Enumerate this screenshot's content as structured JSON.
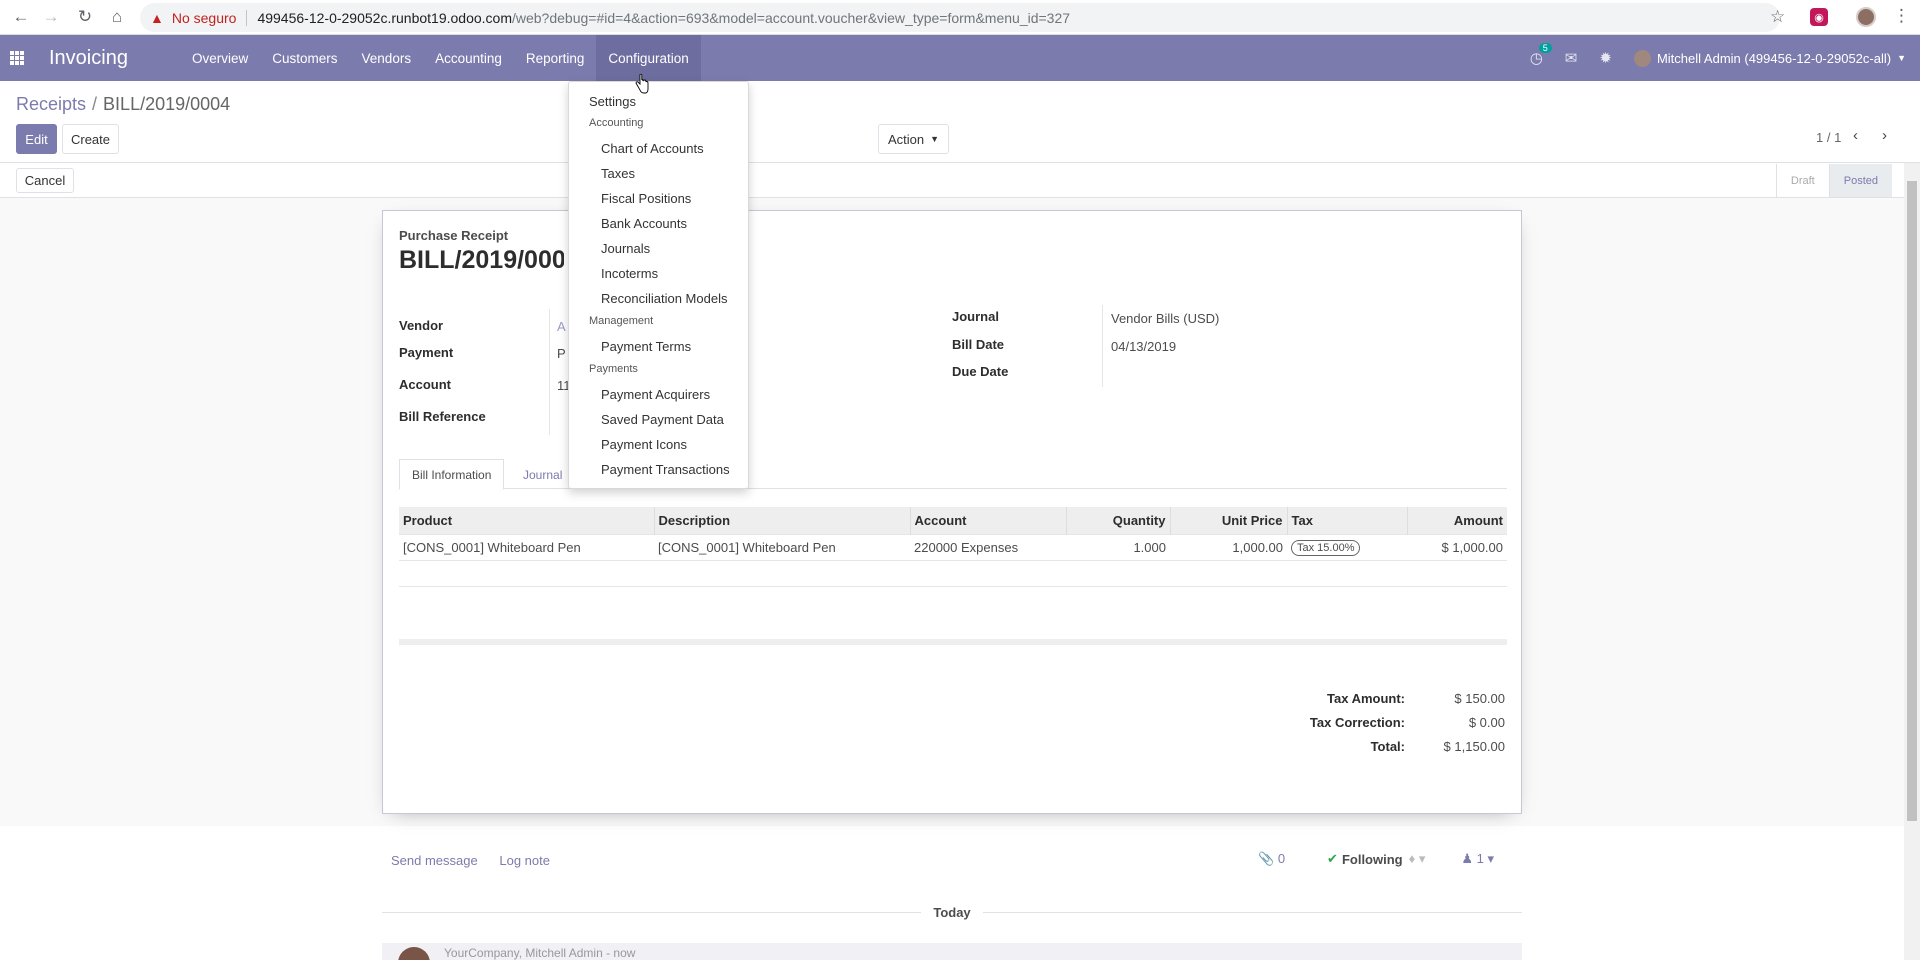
{
  "browser": {
    "insecure_label": "No seguro",
    "url_host": "499456-12-0-29052c.runbot19.odoo.com",
    "url_path": "/web?debug=#id=4&action=693&model=account.voucher&view_type=form&menu_id=327"
  },
  "navbar": {
    "brand": "Invoicing",
    "menu": [
      "Overview",
      "Customers",
      "Vendors",
      "Accounting",
      "Reporting",
      "Configuration"
    ],
    "active_menu": "Configuration",
    "activity_count": "5",
    "user": "Mitchell Admin (499456-12-0-29052c-all)"
  },
  "control_panel": {
    "breadcrumb_parent": "Receipts",
    "breadcrumb_current": "BILL/2019/0004",
    "edit_label": "Edit",
    "create_label": "Create",
    "action_label": "Action",
    "pager": "1 / 1"
  },
  "statusbar": {
    "cancel_label": "Cancel",
    "stages": [
      "Draft",
      "Posted"
    ],
    "current_stage": "Posted"
  },
  "form": {
    "type": "Purchase Receipt",
    "number": "BILL/2019/0004",
    "left_fields": [
      {
        "label": "Vendor",
        "value": "A"
      },
      {
        "label": "Payment",
        "value": "P"
      },
      {
        "label": "Account",
        "value": "11"
      },
      {
        "label": "Bill Reference",
        "value": ""
      }
    ],
    "right_fields": [
      {
        "label": "Journal",
        "value": "Vendor Bills (USD)"
      },
      {
        "label": "Bill Date",
        "value": "04/13/2019"
      },
      {
        "label": "Due Date",
        "value": ""
      }
    ],
    "tabs": [
      "Bill Information",
      "Journal"
    ],
    "lines_header": [
      "Product",
      "Description",
      "Account",
      "Quantity",
      "Unit Price",
      "Tax",
      "Amount"
    ],
    "lines": [
      {
        "product": "[CONS_0001] Whiteboard Pen",
        "description": "[CONS_0001] Whiteboard Pen",
        "account": "220000 Expenses",
        "quantity": "1.000",
        "unit_price": "1,000.00",
        "tax": "Tax 15.00%",
        "amount": "$ 1,000.00"
      }
    ],
    "totals": [
      {
        "label": "Tax Amount:",
        "value": "$ 150.00"
      },
      {
        "label": "Tax Correction:",
        "value": "$ 0.00"
      },
      {
        "label": "Total:",
        "value": "$ 1,150.00"
      }
    ]
  },
  "chatter": {
    "send_message": "Send message",
    "log_note": "Log note",
    "attachments": "0",
    "following": "Following",
    "followers": "1",
    "date_label": "Today",
    "author": "YourCompany, Mitchell Admin",
    "author_suffix": " - now"
  },
  "dropdown": {
    "items": [
      {
        "type": "item",
        "label": "Settings"
      },
      {
        "type": "header",
        "label": "Accounting"
      },
      {
        "type": "item",
        "label": "Chart of Accounts"
      },
      {
        "type": "item",
        "label": "Taxes"
      },
      {
        "type": "item",
        "label": "Fiscal Positions"
      },
      {
        "type": "item",
        "label": "Bank Accounts"
      },
      {
        "type": "item",
        "label": "Journals"
      },
      {
        "type": "item",
        "label": "Incoterms"
      },
      {
        "type": "item",
        "label": "Reconciliation Models"
      },
      {
        "type": "header",
        "label": "Management"
      },
      {
        "type": "item",
        "label": "Payment Terms"
      },
      {
        "type": "header",
        "label": "Payments"
      },
      {
        "type": "item",
        "label": "Payment Acquirers"
      },
      {
        "type": "item",
        "label": "Saved Payment Data"
      },
      {
        "type": "item",
        "label": "Payment Icons"
      },
      {
        "type": "item",
        "label": "Payment Transactions"
      }
    ]
  },
  "colors": {
    "brand": "#7c7bad",
    "insecure": "#c5221f",
    "following_check": "#28a745"
  }
}
